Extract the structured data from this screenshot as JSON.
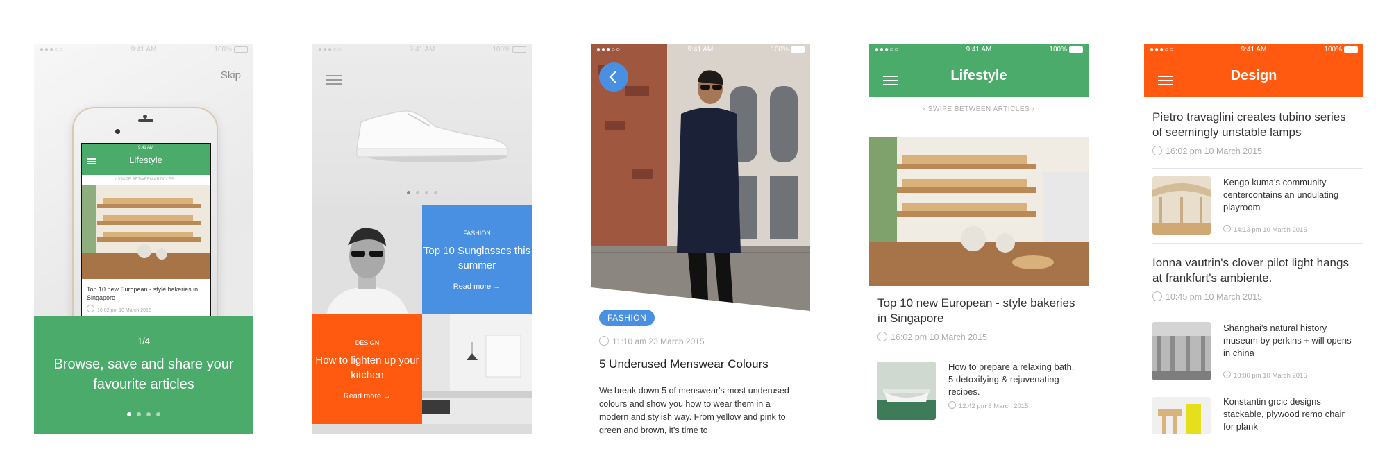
{
  "status": {
    "time": "9:41 AM",
    "battery": "100%",
    "signal": "●●●○○"
  },
  "onboarding": {
    "skip_label": "Skip",
    "phone_title": "Lifestyle",
    "phone_swipe": "‹  SWIPE BETWEEN ARTICLES  ›",
    "phone_caption": "Top 10 new European - style bakeries in Singapore",
    "phone_date": "16:02 pm 10 March 2015",
    "counter": "1/4",
    "message": "Browse, save and share your favourite articles"
  },
  "featured": {
    "tiles": [
      {
        "category": "FASHION",
        "title": "Top 10 Sunglasses this summer",
        "cta": "Read more →"
      },
      {
        "category": "DESIGN",
        "title": "How to lighten up your kitchen",
        "cta": "Read more →"
      }
    ]
  },
  "article": {
    "category": "FASHION",
    "time": "11:10 am 23 March 2015",
    "headline": "5 Underused Menswear Colours",
    "body": "We break down 5 of menswear's most underused colours and show you how to wear them in a modern and stylish way. From yellow and pink to green and brown, it's time to"
  },
  "lifestyle": {
    "title": "Lifestyle",
    "swipe": "‹   SWIPE BETWEEN ARTICLES   ›",
    "main_title": "Top 10 new European - style bakeries in Singapore",
    "main_date": "16:02 pm 10 March 2015",
    "list": [
      {
        "title": "How to prepare a relaxing bath. 5 detoxifying & rejuvenating recipes.",
        "date": "12:42 pm 6 March 2015"
      }
    ]
  },
  "design": {
    "title": "Design",
    "items": [
      {
        "title": "Pietro travaglini creates tubino series of seemingly unstable lamps",
        "date": "16:02 pm 10 March 2015"
      },
      {
        "title": "Kengo kuma's community centercontains an undulating playroom",
        "date": "14:13 pm 10 March 2015"
      },
      {
        "title": "Ionna vautrin's clover pilot light hangs at frankfurt's ambiente.",
        "date": "10:45 pm 10 March 2015"
      },
      {
        "title": "Shanghai's natural history museum by perkins + will opens in china",
        "date": "10:00 pm 10 March 2015"
      },
      {
        "title": "Konstantin grcic designs stackable, plywood remo chair for plank",
        "date": ""
      }
    ]
  },
  "colors": {
    "green": "#4aab6a",
    "blue": "#4a90e2",
    "orange": "#ff5a0f"
  }
}
